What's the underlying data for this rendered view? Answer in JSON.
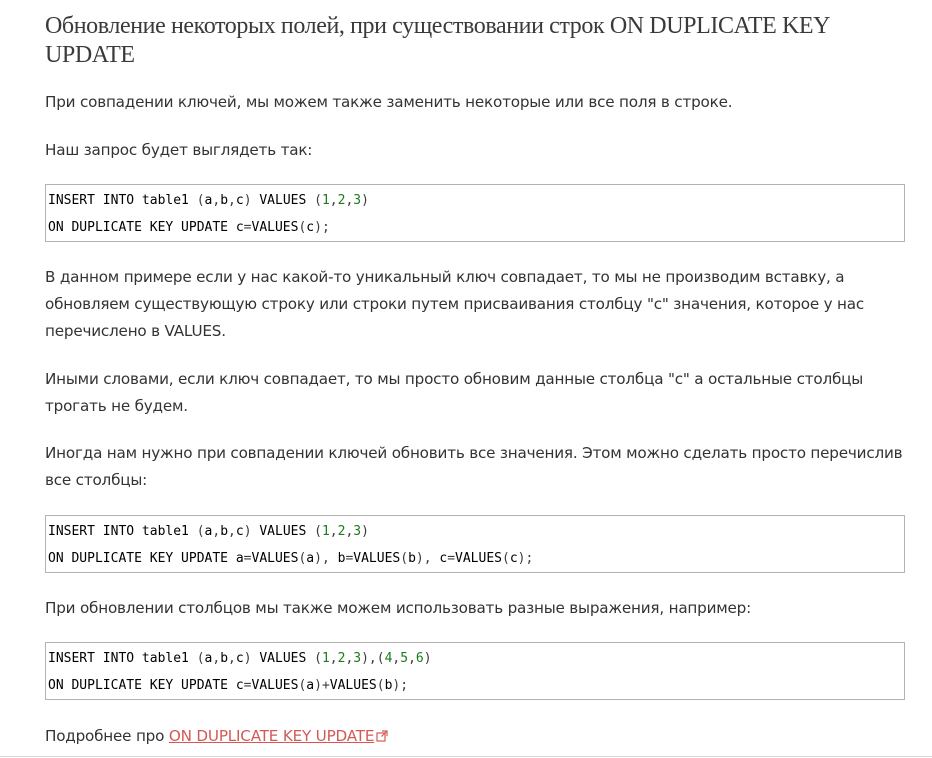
{
  "heading": "Обновление некоторых полей, при существовании строк ON DUPLICATE KEY UPDATE",
  "paragraphs": {
    "p1": "При совпадении ключей, мы можем также заменить некоторые или все поля в строке.",
    "p2": "Наш запрос будет выглядеть так:",
    "p3": "В данном примере если у нас какой-то уникальный ключ совпадает, то мы не производим вставку, а обновляем существующую строку или строки путем присваивания столбцу \"c\" значения, которое у нас перечислено в VALUES.",
    "p4": "Иными словами, если ключ совпадает, то мы просто обновим данные столбца \"c\" а остальные столбцы трогать не будем.",
    "p5": "Иногда нам нужно при совпадении ключей обновить все значения. Этом можно сделать просто перечислив все столбцы:",
    "p6": "При обновлении столбцов мы также можем использовать разные выражения, например:"
  },
  "code_blocks": [
    {
      "lines": [
        [
          [
            "kw",
            "INSERT INTO table1 "
          ],
          [
            "pn",
            "("
          ],
          [
            "kw",
            "a"
          ],
          [
            "pn",
            ","
          ],
          [
            "kw",
            "b"
          ],
          [
            "pn",
            ","
          ],
          [
            "kw",
            "c"
          ],
          [
            "pn",
            ")"
          ],
          [
            "kw",
            " VALUES "
          ],
          [
            "pn",
            "("
          ],
          [
            "nm",
            "1"
          ],
          [
            "pn",
            ","
          ],
          [
            "nm",
            "2"
          ],
          [
            "pn",
            ","
          ],
          [
            "nm",
            "3"
          ],
          [
            "pn",
            ")"
          ]
        ],
        [
          [
            "kw",
            "ON DUPLICATE KEY UPDATE c"
          ],
          [
            "pn",
            "="
          ],
          [
            "kw",
            "VALUES"
          ],
          [
            "pn",
            "("
          ],
          [
            "kw",
            "c"
          ],
          [
            "pn",
            ");"
          ]
        ]
      ]
    },
    {
      "lines": [
        [
          [
            "kw",
            "INSERT INTO table1 "
          ],
          [
            "pn",
            "("
          ],
          [
            "kw",
            "a"
          ],
          [
            "pn",
            ","
          ],
          [
            "kw",
            "b"
          ],
          [
            "pn",
            ","
          ],
          [
            "kw",
            "c"
          ],
          [
            "pn",
            ")"
          ],
          [
            "kw",
            " VALUES "
          ],
          [
            "pn",
            "("
          ],
          [
            "nm",
            "1"
          ],
          [
            "pn",
            ","
          ],
          [
            "nm",
            "2"
          ],
          [
            "pn",
            ","
          ],
          [
            "nm",
            "3"
          ],
          [
            "pn",
            ")"
          ]
        ],
        [
          [
            "kw",
            "ON DUPLICATE KEY UPDATE a"
          ],
          [
            "pn",
            "="
          ],
          [
            "kw",
            "VALUES"
          ],
          [
            "pn",
            "("
          ],
          [
            "kw",
            "a"
          ],
          [
            "pn",
            "),"
          ],
          [
            "kw",
            " b"
          ],
          [
            "pn",
            "="
          ],
          [
            "kw",
            "VALUES"
          ],
          [
            "pn",
            "("
          ],
          [
            "kw",
            "b"
          ],
          [
            "pn",
            "),"
          ],
          [
            "kw",
            " c"
          ],
          [
            "pn",
            "="
          ],
          [
            "kw",
            "VALUES"
          ],
          [
            "pn",
            "("
          ],
          [
            "kw",
            "c"
          ],
          [
            "pn",
            ");"
          ]
        ]
      ]
    },
    {
      "lines": [
        [
          [
            "kw",
            "INSERT INTO table1 "
          ],
          [
            "pn",
            "("
          ],
          [
            "kw",
            "a"
          ],
          [
            "pn",
            ","
          ],
          [
            "kw",
            "b"
          ],
          [
            "pn",
            ","
          ],
          [
            "kw",
            "c"
          ],
          [
            "pn",
            ")"
          ],
          [
            "kw",
            " VALUES "
          ],
          [
            "pn",
            "("
          ],
          [
            "nm",
            "1"
          ],
          [
            "pn",
            ","
          ],
          [
            "nm",
            "2"
          ],
          [
            "pn",
            ","
          ],
          [
            "nm",
            "3"
          ],
          [
            "pn",
            "),("
          ],
          [
            "nm",
            "4"
          ],
          [
            "pn",
            ","
          ],
          [
            "nm",
            "5"
          ],
          [
            "pn",
            ","
          ],
          [
            "nm",
            "6"
          ],
          [
            "pn",
            ")"
          ]
        ],
        [
          [
            "kw",
            "ON DUPLICATE KEY UPDATE c"
          ],
          [
            "pn",
            "="
          ],
          [
            "kw",
            "VALUES"
          ],
          [
            "pn",
            "("
          ],
          [
            "kw",
            "a"
          ],
          [
            "pn",
            ")+"
          ],
          [
            "kw",
            "VALUES"
          ],
          [
            "pn",
            "("
          ],
          [
            "kw",
            "b"
          ],
          [
            "pn",
            ");"
          ]
        ]
      ]
    }
  ],
  "more": {
    "prefix": "Подробнее про ",
    "link_text": "ON DUPLICATE KEY UPDATE",
    "icon": "external-link-icon"
  },
  "colors": {
    "link": "#d45955",
    "text": "#333333",
    "code_border": "#b3b3b3",
    "code_number": "#1d7a1d"
  }
}
